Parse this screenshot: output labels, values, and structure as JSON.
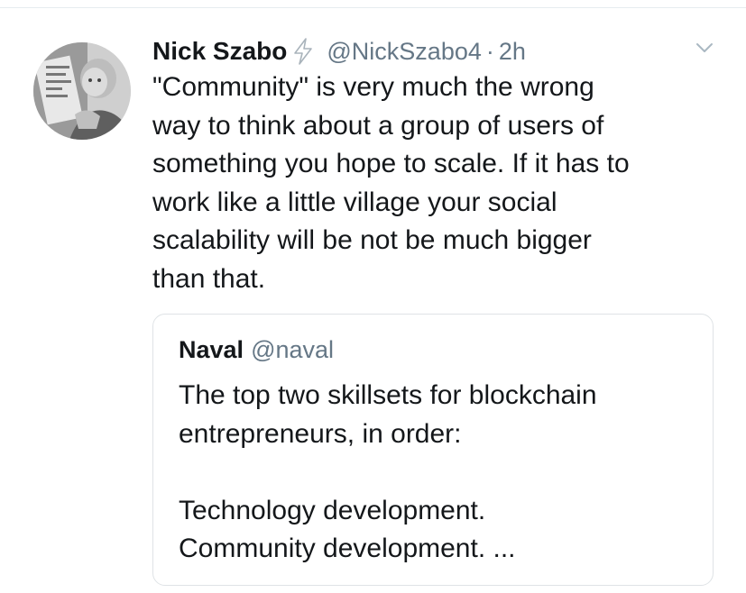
{
  "tweet": {
    "author_name": "Nick Szabo",
    "author_badge_icon": "lightning-bolt-icon",
    "handle": "@NickSzabo4",
    "separator": "·",
    "timestamp": "2h",
    "menu_icon": "chevron-down-icon",
    "text": "\"Community\" is very much the wrong\nway to think about a group of users of\nsomething you hope to scale. If it has to\nwork like a little village your social\nscalability will be not be much bigger\nthan that."
  },
  "quoted_tweet": {
    "author_name": "Naval",
    "handle": "@naval",
    "text": "The top two skillsets for blockchain\nentrepreneurs, in order:\n\nTechnology development.\nCommunity development. ..."
  },
  "colors": {
    "text_primary": "#14171a",
    "text_secondary": "#657786",
    "border": "#dfe3e6"
  }
}
